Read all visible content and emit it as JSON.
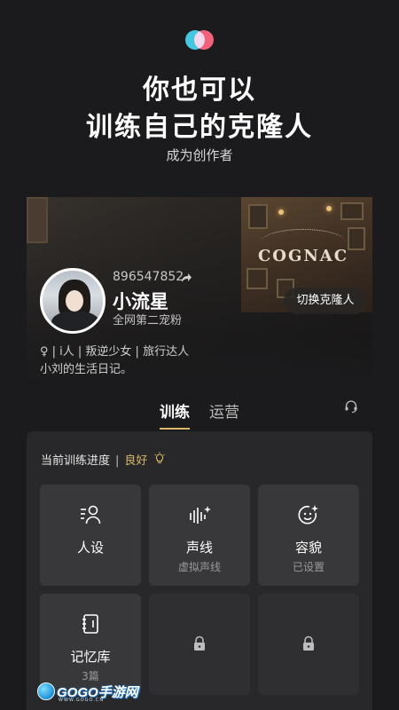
{
  "hero": {
    "title_line1": "你也可以",
    "title_line2": "训练自己的克隆人",
    "subtitle": "成为创作者"
  },
  "profile": {
    "uid": "896547852",
    "name": "小流星",
    "rank": "全网第二宠粉",
    "tags": "♀ | i人 | 叛逆少女 | 旅行达人",
    "bio": "小刘的生活日记。",
    "switch_label": "切换克隆人",
    "poster_brand": "COGNAC"
  },
  "tabs": [
    {
      "label": "训练",
      "active": true
    },
    {
      "label": "运营",
      "active": false
    }
  ],
  "training": {
    "progress_label": "当前训练进度",
    "separator": "|",
    "progress_value": "良好",
    "tiles": [
      {
        "label": "人设",
        "sub": "",
        "icon": "persona-icon"
      },
      {
        "label": "声线",
        "sub": "虚拟声线",
        "icon": "voice-wave-icon"
      },
      {
        "label": "容貌",
        "sub": "已设置",
        "icon": "face-icon"
      },
      {
        "label": "记忆库",
        "sub": "3篇",
        "icon": "notebook-icon"
      },
      {
        "label": "",
        "sub": "",
        "icon": "lock-icon"
      },
      {
        "label": "",
        "sub": "",
        "icon": "lock-icon"
      }
    ]
  },
  "watermark": {
    "text": "GOGO手游网",
    "small": "WWW.GOGO.CN"
  },
  "colors": {
    "background": "#1b1b1d",
    "panel": "#28282a",
    "tile": "#38383b",
    "accent": "#d9b867"
  }
}
